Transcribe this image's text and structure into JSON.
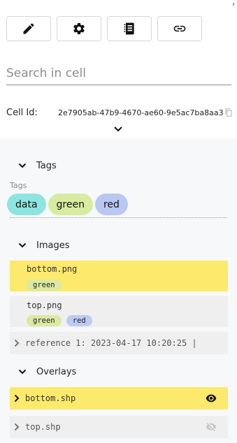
{
  "collapse_glyph": "›",
  "toolbar": {
    "buttons": [
      {
        "icon": "pencil-icon"
      },
      {
        "icon": "gear-icon"
      },
      {
        "icon": "notebook-icon"
      },
      {
        "icon": "link-icon"
      }
    ]
  },
  "search": {
    "placeholder": "Search in cell",
    "value": ""
  },
  "cell": {
    "label": "Cell Id:",
    "id": "2e7905ab-47b9-4670-ae60-9e5ac7ba8aa3"
  },
  "tags": {
    "title": "Tags",
    "caption": "Tags",
    "items": [
      {
        "label": "data",
        "color": "#8ee5df"
      },
      {
        "label": "green",
        "color": "#d7eca0"
      },
      {
        "label": "red",
        "color": "#b9c8f3"
      }
    ]
  },
  "images": {
    "title": "Images",
    "items": [
      {
        "name": "bottom.png",
        "highlight": "#fde96b",
        "tags": [
          {
            "label": "green",
            "color": "#dbe9a3"
          }
        ]
      },
      {
        "name": "top.png",
        "highlight": "#efefef",
        "tags": [
          {
            "label": "green",
            "color": "#dbe9a3"
          },
          {
            "label": "red",
            "color": "#bccbf3"
          }
        ]
      }
    ],
    "reference": "reference 1: 2023-04-17 10:20:25 |"
  },
  "overlays": {
    "title": "Overlays",
    "items": [
      {
        "name": "bottom.shp",
        "highlight": "#fde96b",
        "visible": true
      },
      {
        "name": "top.shp",
        "highlight": "#efefef",
        "visible": false
      }
    ]
  }
}
